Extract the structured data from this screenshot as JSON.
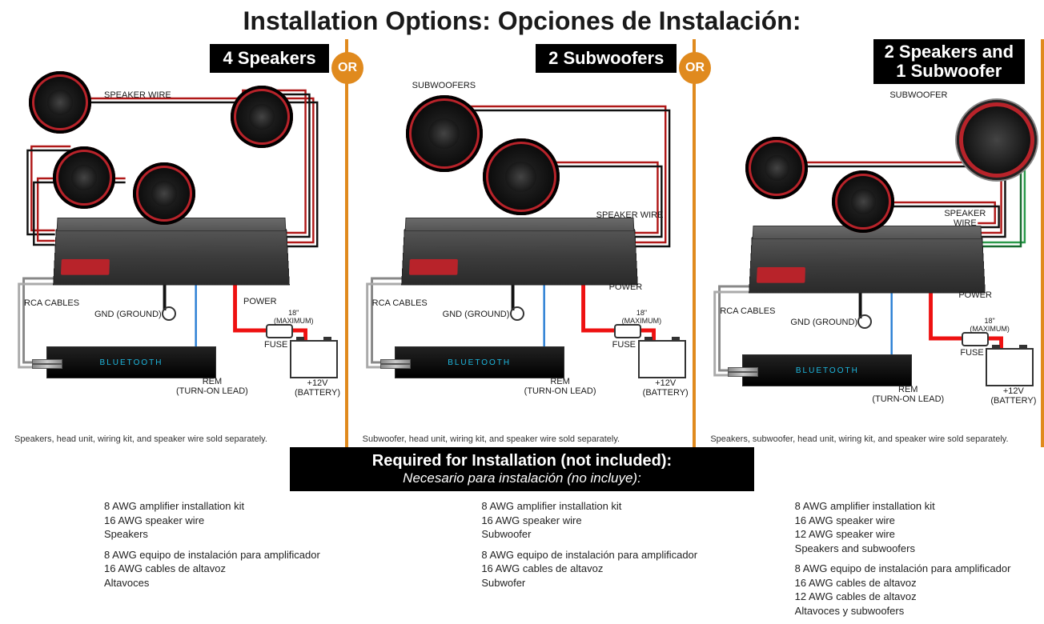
{
  "title": "Installation Options:   Opciones de Instalación:",
  "orText": "OR",
  "options": [
    {
      "label": "4 Speakers",
      "topCenterLabel": "SPEAKER WIRE",
      "disclaimer": "Speakers, head unit, wiring kit, and speaker wire sold separately."
    },
    {
      "label": "2 Subwoofers",
      "topCenterLabel": "SUBWOOFERS",
      "speakerWireLabel": "SPEAKER WIRE",
      "disclaimer": "Subwoofer, head unit, wiring kit, and speaker wire sold separately."
    },
    {
      "label": "2 Speakers and\n1 Subwoofer",
      "topCenterLabel": "SUBWOOFER",
      "speakerWireLabel": "SPEAKER\nWIRE",
      "disclaimer": "Speakers, subwoofer, head unit, wiring kit, and speaker wire sold separately."
    }
  ],
  "commonLabels": {
    "power": "POWER",
    "rca": "RCA CABLES",
    "gnd": "GND (GROUND)",
    "rem": "REM\n(TURN-ON LEAD)",
    "fuse": "FUSE",
    "maxLen": "18\"\n(MAXIMUM)",
    "battery": "+12V\n(BATTERY)",
    "headunit": "BLUETOOTH"
  },
  "requiredBanner": {
    "line1": "Required for Installation (not included):",
    "line2": "Necesario para instalación (no incluye):"
  },
  "requiredLists": [
    {
      "en": [
        "8 AWG amplifier installation kit",
        "16 AWG speaker wire",
        "Speakers"
      ],
      "es": [
        "8 AWG equipo de instalación para amplificador",
        "16 AWG cables de altavoz",
        "Altavoces"
      ]
    },
    {
      "en": [
        "8 AWG amplifier installation kit",
        "16 AWG speaker wire",
        "Subwoofer"
      ],
      "es": [
        "8 AWG equipo de instalación para amplificador",
        "16 AWG cables de altavoz",
        "Subwofer"
      ]
    },
    {
      "en": [
        "8 AWG amplifier installation kit",
        "16 AWG speaker wire",
        "12 AWG  speaker wire",
        "Speakers and subwoofers"
      ],
      "es": [
        "8 AWG equipo de instalación para amplificador",
        "16 AWG cables de altavoz",
        "12 AWG  cables de altavoz",
        "Altavoces y subwoofers"
      ]
    }
  ]
}
